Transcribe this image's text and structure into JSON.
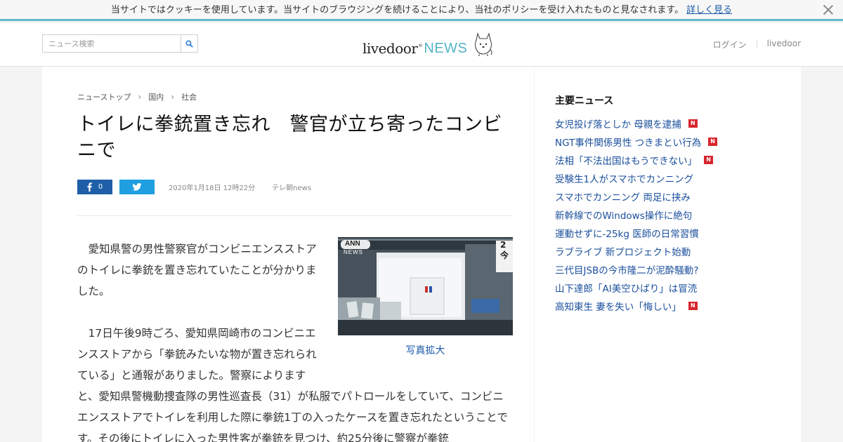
{
  "cookie_bar": {
    "message": "当サイトではクッキーを使用しています。当サイトのブラウジングを続けることにより、当社のポリシーを受け入れたものと見なされます。",
    "more_link": "詳しく見る"
  },
  "header": {
    "search": {
      "placeholder": "ニュース検索"
    },
    "logo": {
      "livedoor": "livedoor",
      "trademark": "®",
      "news": "NEWS"
    },
    "links": {
      "login": "ログイン",
      "livedoor": "livedoor"
    }
  },
  "article": {
    "breadcrumb": [
      "ニューストップ",
      "国内",
      "社会"
    ],
    "title": "トイレに拳銃置き忘れ　警官が立ち寄ったコンビニで",
    "share": {
      "facebook_count": "0"
    },
    "date": "2020年1月18日 12時22分",
    "source": "テレ朝news",
    "photo": {
      "watermark_top": "ANN",
      "watermark_bottom": "NEWS",
      "sign": "2今",
      "caption": "写真拡大"
    },
    "paragraphs": [
      "愛知県警の男性警察官がコンビニエンスストアのトイレに拳銃を置き忘れていたことが分かりました。",
      "17日午後9時ごろ、愛知県岡崎市のコンビニエンスストアから「拳銃みたいな物が置き忘れられている」と通報がありました。警察によりますと、愛知県警機動捜査隊の男性巡査長（31）が私服でパトロールをしていて、コンビニエンスストアでトイレを利用した際に拳銃1丁の入ったケースを置き忘れたということです。その後にトイレに入った男性客が拳銃を見つけ、約25分後に警察が拳銃"
    ]
  },
  "sidebar": {
    "title": "主要ニュース",
    "badge_label": "N",
    "items": [
      {
        "text": "女児投げ落としか 母親を逮捕",
        "new": true
      },
      {
        "text": "NGT事件関係男性 つきまとい行為",
        "new": true
      },
      {
        "text": "法相「不法出国はもうできない」",
        "new": true
      },
      {
        "text": "受験生1人がスマホでカンニング",
        "new": false
      },
      {
        "text": "スマホでカンニング 両足に挟み",
        "new": false
      },
      {
        "text": "新幹線でのWindows操作に絶句",
        "new": false
      },
      {
        "text": "運動せずに-25kg 医師の日常習慣",
        "new": false
      },
      {
        "text": "ラブライブ 新プロジェクト始動",
        "new": false
      },
      {
        "text": "三代目JSBの今市隆二が泥酔騒動?",
        "new": false
      },
      {
        "text": "山下達郎「AI美空ひばり」は冒涜",
        "new": false
      },
      {
        "text": "高知東生 妻を失い「悔しい」",
        "new": true
      }
    ]
  },
  "colors": {
    "accent": "#5fb8c8",
    "link": "#1a4f9c",
    "facebook": "#1e5fa8",
    "twitter": "#1f9fe0",
    "new_badge": "#d8262e"
  }
}
